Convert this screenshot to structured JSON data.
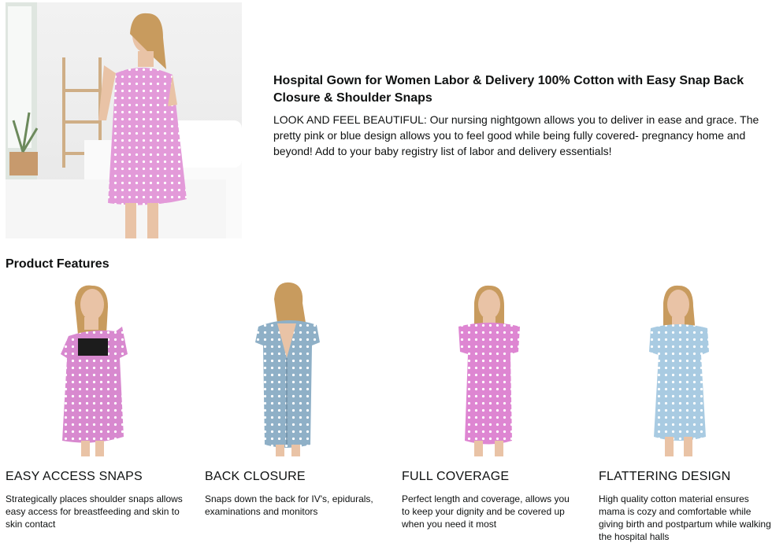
{
  "hero": {
    "image_alt": "Woman in pink polka dot hospital gown in bedroom",
    "title": "Hospital Gown for Women Labor & Delivery 100% Cotton with Easy Snap Back Closure & Shoulder Snaps",
    "description": "LOOK AND FEEL BEAUTIFUL: Our nursing nightgown allows you to deliver in ease and grace. The pretty pink or blue design allows you to feel good while being fully covered- pregnancy home and beyond! Add to your baby registry list of labor and delivery essentials!"
  },
  "features_section": {
    "title": "Product Features",
    "items": [
      {
        "heading": "EASY ACCESS SNAPS",
        "text": "Strategically places shoulder snaps allows easy access for breastfeeding and skin to skin contact",
        "gown_color": "#d889cf"
      },
      {
        "heading": "BACK CLOSURE",
        "text": "Snaps down the back for IV's, epidurals, examinations and monitors",
        "gown_color": "#8fb0c7"
      },
      {
        "heading": "FULL COVERAGE",
        "text": "Perfect length and coverage, allows you to keep your dignity and be covered up when you need it most",
        "gown_color": "#de86d2"
      },
      {
        "heading": "FLATTERING DESIGN",
        "text": "High quality cotton material ensures mama is cozy and comfortable while giving birth and postpartum while walking the hospital halls",
        "gown_color": "#a9cbe2"
      }
    ]
  }
}
